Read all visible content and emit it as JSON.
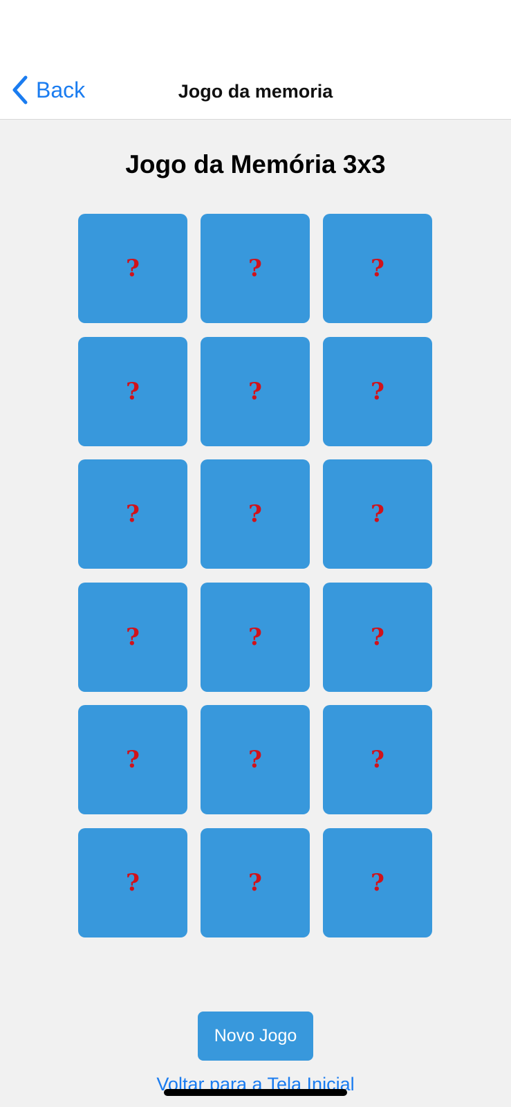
{
  "nav": {
    "back_label": "Back",
    "title": "Jogo da memoria"
  },
  "page": {
    "title": "Jogo da Memória 3x3"
  },
  "cards": [
    {
      "symbol": "?"
    },
    {
      "symbol": "?"
    },
    {
      "symbol": "?"
    },
    {
      "symbol": "?"
    },
    {
      "symbol": "?"
    },
    {
      "symbol": "?"
    },
    {
      "symbol": "?"
    },
    {
      "symbol": "?"
    },
    {
      "symbol": "?"
    },
    {
      "symbol": "?"
    },
    {
      "symbol": "?"
    },
    {
      "symbol": "?"
    },
    {
      "symbol": "?"
    },
    {
      "symbol": "?"
    },
    {
      "symbol": "?"
    },
    {
      "symbol": "?"
    },
    {
      "symbol": "?"
    },
    {
      "symbol": "?"
    }
  ],
  "actions": {
    "new_game_label": "Novo Jogo",
    "back_home_label": "Voltar para a Tela Inicial"
  },
  "colors": {
    "accent": "#1a7cf0",
    "card": "#3898dc",
    "card_symbol": "#d0121b",
    "background": "#f1f1f1"
  },
  "icons": {
    "back": "chevron-left-icon"
  }
}
